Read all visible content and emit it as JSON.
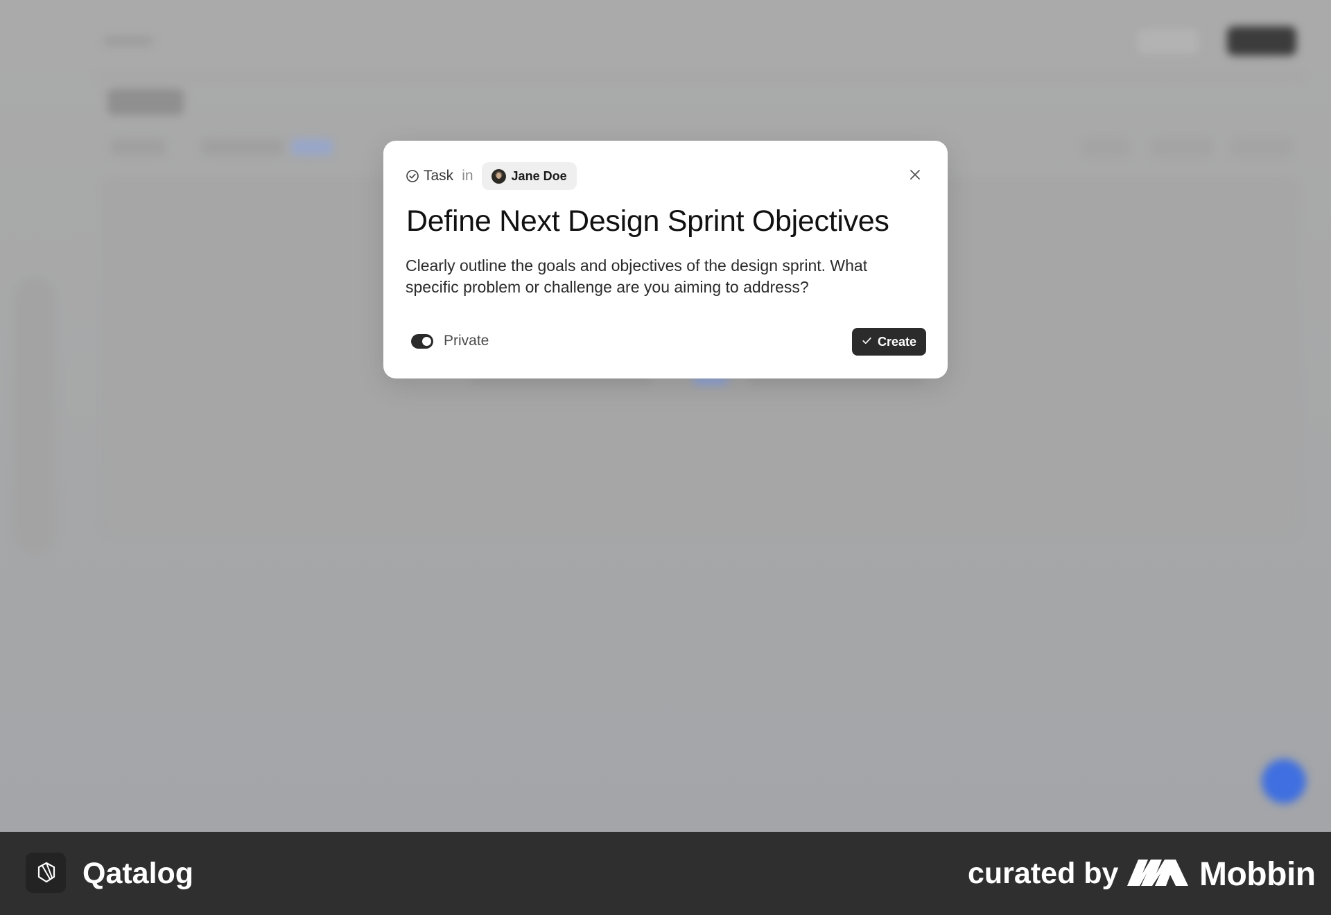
{
  "modal": {
    "type_label": "Task",
    "in_text": "in",
    "owner_name": "Jane Doe",
    "title": "Define Next Design Sprint Objectives",
    "description": "Clearly outline the goals and objectives of the design sprint. What specific problem or challenge are you aiming to address?",
    "private_label": "Private",
    "private_on": true,
    "create_label": "Create",
    "icons": {
      "type": "check-circle-icon",
      "avatar": "avatar",
      "close": "close-icon",
      "create": "check-icon"
    }
  },
  "footer": {
    "app_name": "Qatalog",
    "curated_by": "curated by",
    "brand_name": "Mobbin"
  },
  "colors": {
    "overlay_bg": "#a9aaab",
    "modal_bg": "#ffffff",
    "primary_button": "#2b2b2b",
    "footer_bg": "#2f2f2f",
    "fab_accent": "#3f6fe0"
  }
}
